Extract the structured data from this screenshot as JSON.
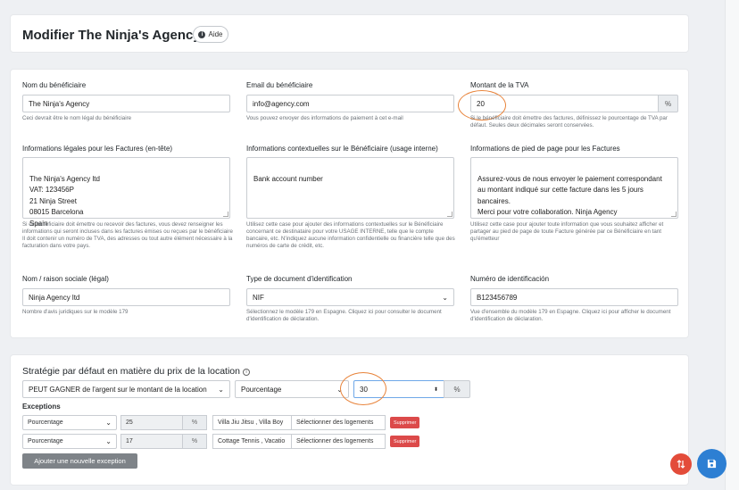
{
  "header": {
    "title": "Modifier The Ninja's Agency",
    "help_label": "Aide"
  },
  "beneficiary": {
    "name_label": "Nom du bénéficiaire",
    "name_value": "The Ninja's Agency",
    "name_help": "Ceci devrait être le nom légal du bénéficiaire",
    "email_label": "Email du bénéficiaire",
    "email_value": "info@agency.com",
    "email_help": "Vous pouvez envoyer des informations de paiement à cet e-mail",
    "vat_label": "Montant de la TVA",
    "vat_value": "20",
    "vat_unit": "%",
    "vat_help": "Si le bénéficiaire doit émettre des factures, définissez le pourcentage de TVA par défaut. Seules deux décimales seront conservées."
  },
  "invoice": {
    "legal_label": "Informations légales pour les Factures (en-tête)",
    "legal_value": "The Ninja's Agency ltd\nVAT: 123456P\n21 Ninja Street\n08015 Barcelona\nSpain",
    "legal_help": "Si ce bénéficiaire doit émettre ou recevoir des factures, vous devez renseigner les informations qui seront incluses dans les factures émises ou reçues par le bénéficiaire\nIl doit contenir un numéro de TVA, des adresses ou tout autre élément nécessaire à la facturation dans votre pays.",
    "context_label": "Informations contextuelles sur le Bénéficiaire (usage interne)",
    "context_value": "Bank account number",
    "context_help": "Utilisez cette case pour ajouter des informations contextuelles sur le Bénéficiaire concernant ce destinataire pour votre USAGE INTERNE, telle que le compte bancaire, etc. N'indiquez aucune information confidentielle ou financière telle que des numéros de carte de crédit, etc.",
    "footer_label": "Informations de pied de page pour les Factures",
    "footer_value": "Assurez-vous de nous envoyer le paiement correspondant au montant indiqué sur cette facture dans les 5 jours bancaires.\nMerci pour votre collaboration. Ninja Agency",
    "footer_help": "Utilisez cette case pour ajouter toute information que vous souhaitez afficher et partager au pied de page de toute Facture générée par ce Bénéficiaire en tant qu'émetteur"
  },
  "identity": {
    "company_label": "Nom / raison sociale (légal)",
    "company_value": "Ninja Agency ltd",
    "company_help": "Nombre d'avis juridiques sur le modèle 179",
    "doctype_label": "Type de document d'identification",
    "doctype_value": "NIF",
    "doctype_help": "Sélectionnez le modèle 179 en Espagne. Cliquez ici pour consulter le document d'identification de déclaration.",
    "idnum_label": "Numéro de identificación",
    "idnum_value": "B123456789",
    "idnum_help": "Vue d'ensemble du modèle 179 en Espagne. Cliquez ici pour afficher le document d'identification de déclaration."
  },
  "pricing": {
    "title": "Stratégie par défaut en matière du prix de la location",
    "strategy_value": "PEUT GAGNER de l'argent sur le montant de la location",
    "mode_value": "Pourcentage",
    "amount_value": "30",
    "unit": "%",
    "exceptions_label": "Exceptions",
    "exceptions": [
      {
        "mode": "Pourcentage",
        "value": "25",
        "unit": "%",
        "listings": "Villa Jiu Jitsu , Villa Boy",
        "select_label": "Sélectionner des logements",
        "delete_label": "Supprimer"
      },
      {
        "mode": "Pourcentage",
        "value": "17",
        "unit": "%",
        "listings": "Cottage Tennis , Vacatio",
        "select_label": "Sélectionner des logements",
        "delete_label": "Supprimer"
      }
    ],
    "add_exception_label": "Ajouter une nouvelle exception"
  },
  "colors": {
    "accent_circle": "#e8833a",
    "delete": "#dc4a4a",
    "save_fab": "#2d7fd3",
    "sort_fab": "#e34c3a"
  },
  "icons": {
    "help": "info-circle-icon",
    "save": "floppy-disk-icon",
    "sort": "sort-arrows-icon"
  }
}
